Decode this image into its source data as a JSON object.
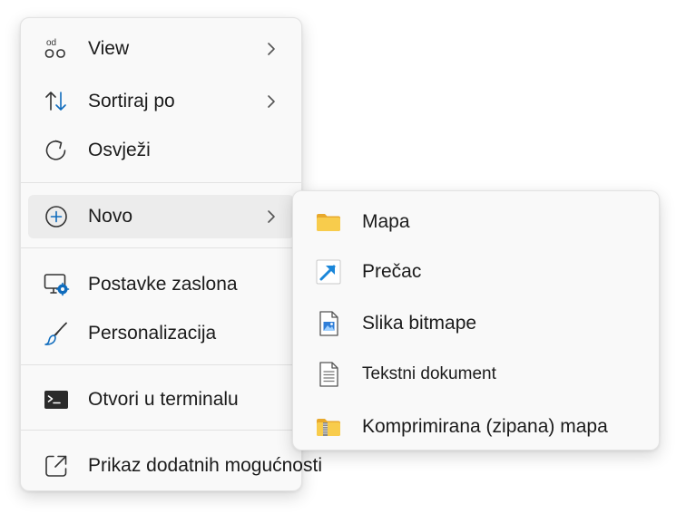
{
  "context_menu": {
    "items": [
      {
        "label": "View",
        "icon": "view-icon",
        "has_submenu": true
      },
      {
        "label": "Sortiraj po",
        "icon": "sort-icon",
        "has_submenu": true
      },
      {
        "label": "Osvježi",
        "icon": "refresh-icon",
        "has_submenu": false
      },
      {
        "label": "Novo",
        "icon": "new-icon",
        "has_submenu": true,
        "state": "highlighted"
      },
      {
        "label": "Postavke zaslona",
        "icon": "display-settings-icon",
        "has_submenu": false
      },
      {
        "label": "Personalizacija",
        "icon": "personalize-brush-icon",
        "has_submenu": false
      },
      {
        "label": "Otvori u terminalu",
        "icon": "terminal-icon",
        "has_submenu": false
      },
      {
        "label": "Prikaz dodatnih mogućnosti",
        "icon": "more-options-icon",
        "has_submenu": false
      }
    ],
    "view_icon_text": "od"
  },
  "submenu": {
    "items": [
      {
        "label": "Mapa",
        "icon": "folder-icon"
      },
      {
        "label": "Prečac",
        "icon": "shortcut-icon"
      },
      {
        "label": "Slika bitmape",
        "icon": "bitmap-image-icon"
      },
      {
        "label": "Tekstni dokument",
        "icon": "text-document-icon"
      },
      {
        "label": "Komprimirana (zipana) mapa",
        "icon": "zip-folder-icon"
      }
    ]
  },
  "colors": {
    "menu_background": "#f9f9f9",
    "hover_background": "#ececec",
    "accent_blue": "#0f6cbd",
    "folder_yellow": "#f5c33b"
  }
}
